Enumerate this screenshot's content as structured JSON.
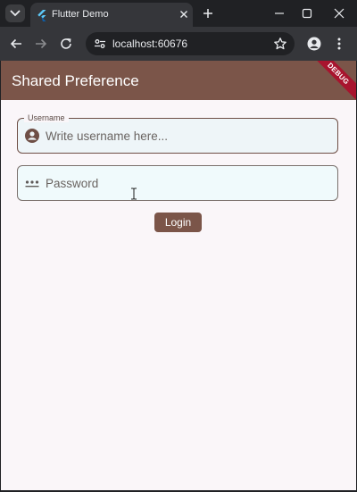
{
  "browser": {
    "tab_title": "Flutter Demo",
    "url": "localhost:60676"
  },
  "app": {
    "title": "Shared Preference",
    "debug_banner": "DEBUG",
    "username": {
      "label": "Username",
      "placeholder": "Write username here...",
      "value": ""
    },
    "password": {
      "placeholder": "Password",
      "value": ""
    },
    "login_label": "Login"
  },
  "colors": {
    "app_bar": "#7b5549",
    "page_background": "#faf6f9",
    "debug_ribbon": "#a8142e",
    "browser_frame": "#202124",
    "toolbar": "#35363a"
  },
  "icons": {
    "tab_menu": "chevron-down-icon",
    "favicon": "flutter-logo-icon",
    "tab_close": "close-icon",
    "new_tab": "plus-icon",
    "back": "arrow-left-icon",
    "forward": "arrow-right-icon",
    "reload": "reload-icon",
    "site_info": "tune-icon",
    "bookmark": "star-icon",
    "profile": "person-icon",
    "menu": "kebab-icon",
    "username": "account-circle-icon",
    "password": "password-dots-icon"
  }
}
